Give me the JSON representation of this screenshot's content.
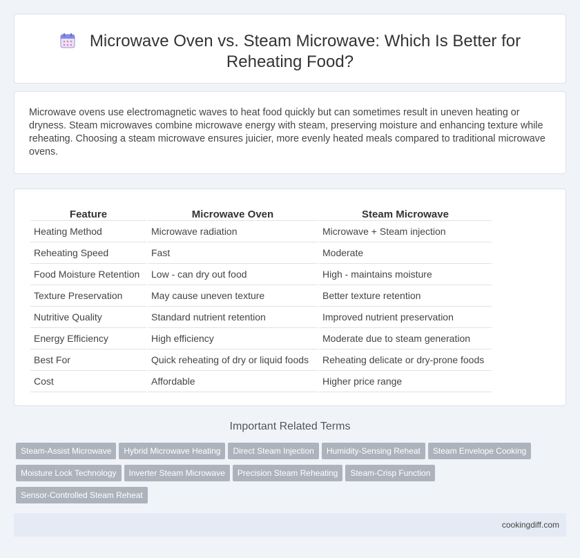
{
  "header": {
    "title_line1": "Microwave Oven vs. Steam Microwave: Which Is Better for",
    "title_line2": "Reheating Food?",
    "icon": "calendar-icon"
  },
  "intro": {
    "text": "Microwave ovens use electromagnetic waves to heat food quickly but can sometimes result in uneven heating or dryness. Steam microwaves combine microwave energy with steam, preserving moisture and enhancing texture while reheating. Choosing a steam microwave ensures juicier, more evenly heated meals compared to traditional microwave ovens."
  },
  "table": {
    "headers": [
      "Feature",
      "Microwave Oven",
      "Steam Microwave"
    ],
    "rows": [
      [
        "Heating Method",
        "Microwave radiation",
        "Microwave + Steam injection"
      ],
      [
        "Reheating Speed",
        "Fast",
        "Moderate"
      ],
      [
        "Food Moisture Retention",
        "Low - can dry out food",
        "High - maintains moisture"
      ],
      [
        "Texture Preservation",
        "May cause uneven texture",
        "Better texture retention"
      ],
      [
        "Nutritive Quality",
        "Standard nutrient retention",
        "Improved nutrient preservation"
      ],
      [
        "Energy Efficiency",
        "High efficiency",
        "Moderate due to steam generation"
      ],
      [
        "Best For",
        "Quick reheating of dry or liquid foods",
        "Reheating delicate or dry-prone foods"
      ],
      [
        "Cost",
        "Affordable",
        "Higher price range"
      ]
    ]
  },
  "related": {
    "heading": "Important Related Terms",
    "tags": [
      "Steam-Assist Microwave",
      "Hybrid Microwave Heating",
      "Direct Steam Injection",
      "Humidity-Sensing Reheat",
      "Steam Envelope Cooking",
      "Moisture Lock Technology",
      "Inverter Steam Microwave",
      "Precision Steam Reheating",
      "Steam-Crisp Function",
      "Sensor-Controlled Steam Reheat"
    ]
  },
  "footer": {
    "site": "cookingdiff.com"
  },
  "colors": {
    "background": "#f0f3f8",
    "tag_bg": "#adb3bc",
    "footer_bg": "#e5ebf5"
  }
}
